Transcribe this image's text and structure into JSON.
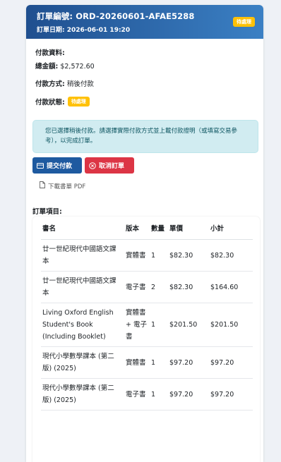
{
  "header": {
    "order_number": "訂單編號: ORD-20260601-AFAE5288",
    "order_date": "訂單日期: 2026-06-01 19:20",
    "status_badge": "待處理"
  },
  "payment": {
    "section_label": "付款資料:",
    "total_label": "總金額:",
    "total_value": "$2,572.60",
    "method_label": "付款方式:",
    "method_value": "稍後付款",
    "status_label": "付款狀態:",
    "status_badge": "待處理"
  },
  "alert": {
    "text": "您已選擇稍後付款。請選擇實際付款方式並上載付款證明（或填寫交易參考），以完成訂單。"
  },
  "actions": {
    "submit_payment": "提交付款",
    "cancel_order": "取消訂單",
    "download_pdf": "下載書單 PDF"
  },
  "items": {
    "label": "訂單項目:",
    "headers": {
      "name": "書名",
      "version": "版本",
      "qty": "數量",
      "price": "單價",
      "subtotal": "小計"
    },
    "rows": [
      {
        "name": "廿一世紀現代中國語文課本",
        "version": "實體書",
        "qty": "1",
        "price": "$82.30",
        "subtotal": "$82.30"
      },
      {
        "name": "廿一世紀現代中國語文課本",
        "version": "電子書",
        "qty": "2",
        "price": "$82.30",
        "subtotal": "$164.60"
      },
      {
        "name": "Living Oxford English Student's Book (Including Booklet)",
        "version": "實體書 + 電子書",
        "qty": "1",
        "price": "$201.50",
        "subtotal": "$201.50"
      },
      {
        "name": "現代小學數學課本 (第二版) (2025)",
        "version": "實體書",
        "qty": "1",
        "price": "$97.20",
        "subtotal": "$97.20"
      },
      {
        "name": "現代小學數學課本 (第二版) (2025)",
        "version": "電子書",
        "qty": "1",
        "price": "$97.20",
        "subtotal": "$97.20"
      }
    ]
  },
  "colors": {
    "header_start": "#1f4f8f",
    "header_end": "#3b80c4",
    "badge_warning": "#ffc107",
    "primary": "#1e5aa0",
    "danger": "#dc3545",
    "alert_bg": "#d1ecf1"
  },
  "icons": {
    "submit": "credit-card-icon",
    "cancel": "close-circle-icon",
    "pdf": "file-icon"
  }
}
